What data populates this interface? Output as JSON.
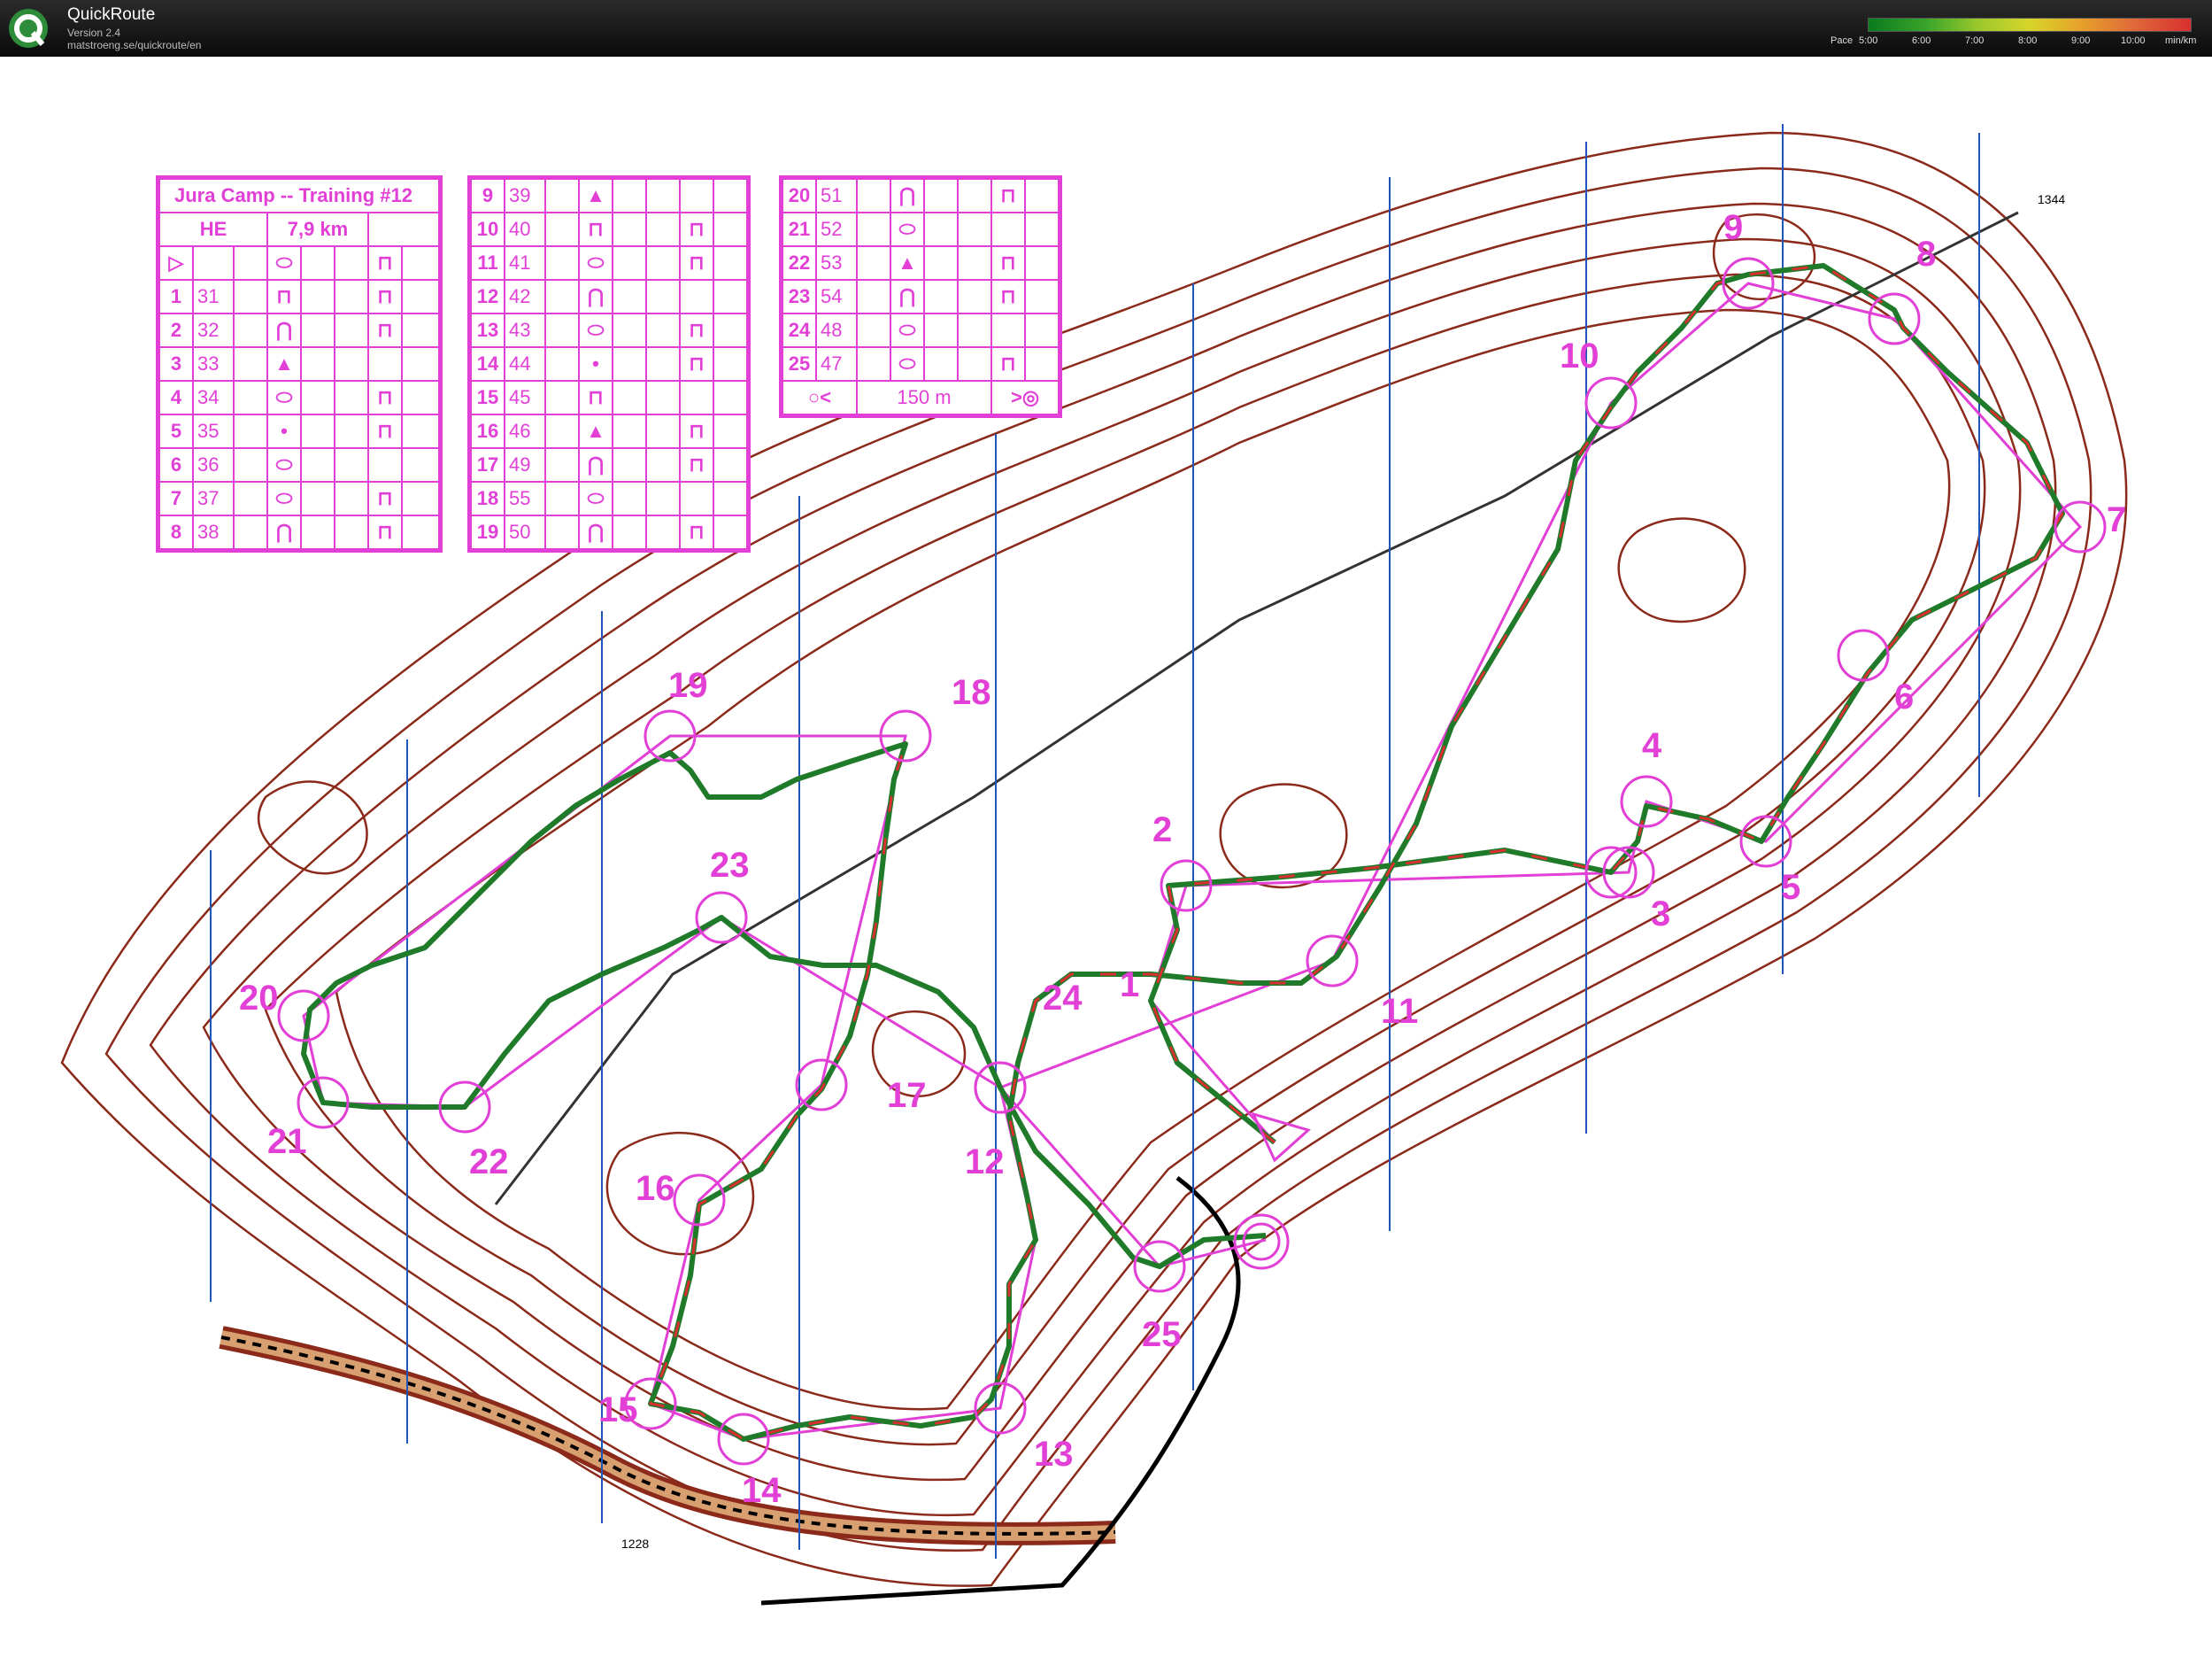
{
  "app": {
    "name": "QuickRoute",
    "version": "Version 2.4",
    "url": "matstroeng.se/quickroute/en"
  },
  "pace_legend": {
    "label": "Pace",
    "ticks": [
      "5:00",
      "6:00",
      "7:00",
      "8:00",
      "9:00",
      "10:00"
    ],
    "unit": "min/km",
    "colors": [
      "#0a7a1e",
      "#3aa52a",
      "#9bc82a",
      "#d7d52a",
      "#e6a12a",
      "#e06a3a",
      "#d83030"
    ]
  },
  "colors": {
    "course": "#e23fd6",
    "contour": "#8b2a1a",
    "route_fast": "#1f7a2a",
    "route_slow": "#d83030",
    "magnetic_north": "#1f56b8"
  },
  "description_sheet": {
    "title": "Jura Camp -- Training #12",
    "category": "HE",
    "length": "7,9 km",
    "start_symbol": "triangle",
    "finish_distance": "150 m",
    "controls": [
      {
        "num": "1",
        "code": "31"
      },
      {
        "num": "2",
        "code": "32"
      },
      {
        "num": "3",
        "code": "33"
      },
      {
        "num": "4",
        "code": "34"
      },
      {
        "num": "5",
        "code": "35"
      },
      {
        "num": "6",
        "code": "36"
      },
      {
        "num": "7",
        "code": "37"
      },
      {
        "num": "8",
        "code": "38"
      },
      {
        "num": "9",
        "code": "39"
      },
      {
        "num": "10",
        "code": "40"
      },
      {
        "num": "11",
        "code": "41"
      },
      {
        "num": "12",
        "code": "42"
      },
      {
        "num": "13",
        "code": "43"
      },
      {
        "num": "14",
        "code": "44"
      },
      {
        "num": "15",
        "code": "45"
      },
      {
        "num": "16",
        "code": "46"
      },
      {
        "num": "17",
        "code": "49"
      },
      {
        "num": "18",
        "code": "55"
      },
      {
        "num": "19",
        "code": "50"
      },
      {
        "num": "20",
        "code": "51"
      },
      {
        "num": "21",
        "code": "52"
      },
      {
        "num": "22",
        "code": "53"
      },
      {
        "num": "23",
        "code": "54"
      },
      {
        "num": "24",
        "code": "48"
      },
      {
        "num": "25",
        "code": "47"
      }
    ]
  },
  "map": {
    "spot_heights": [
      "1344",
      "1228"
    ],
    "control_labels": [
      "1",
      "2",
      "3",
      "4",
      "5",
      "6",
      "7",
      "8",
      "9",
      "10",
      "11",
      "12",
      "13",
      "14",
      "15",
      "16",
      "17",
      "18",
      "19",
      "20",
      "21",
      "22",
      "23",
      "24",
      "25"
    ]
  }
}
